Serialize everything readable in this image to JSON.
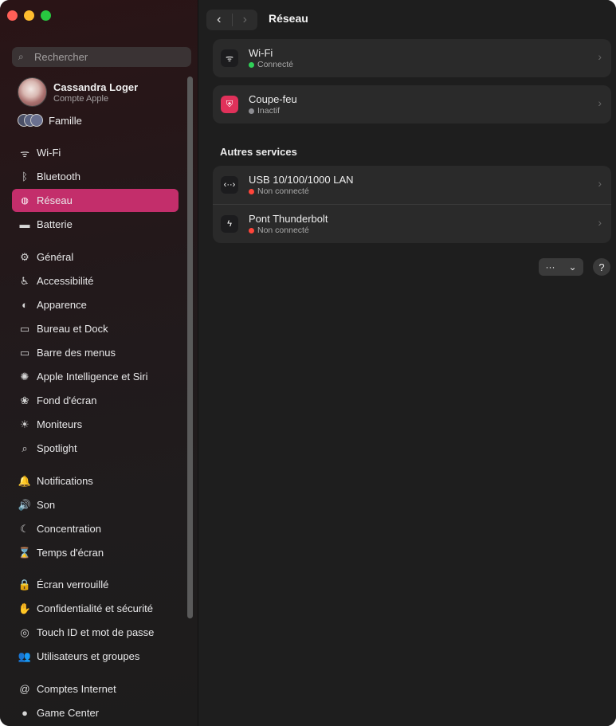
{
  "window": {
    "title": "Réseau"
  },
  "sidebar": {
    "search_placeholder": "Rechercher",
    "account": {
      "name": "Cassandra Loger",
      "subtitle": "Compte Apple"
    },
    "family_label": "Famille",
    "items": [
      {
        "label": "Wi-Fi",
        "icon": "wifi-icon",
        "glyph": "ᯤ",
        "color": "#3a3a3a"
      },
      {
        "label": "Bluetooth",
        "icon": "bluetooth-icon",
        "glyph": "ᛒ",
        "color": "#3a3a3a"
      },
      {
        "label": "Réseau",
        "icon": "globe-icon",
        "glyph": "◍",
        "color": "#c32e6b"
      },
      {
        "label": "Batterie",
        "icon": "battery-icon",
        "glyph": "▬",
        "color": "#3a3a3a"
      },
      {
        "label": "Général",
        "icon": "gear-icon",
        "glyph": "⚙",
        "color": "#3a3a3a"
      },
      {
        "label": "Accessibilité",
        "icon": "accessibility-icon",
        "glyph": "♿",
        "color": "#3a3a3a"
      },
      {
        "label": "Apparence",
        "icon": "appearance-icon",
        "glyph": "◐",
        "color": "#3a3a3a"
      },
      {
        "label": "Bureau et Dock",
        "icon": "dock-icon",
        "glyph": "▭",
        "color": "#3a3a3a"
      },
      {
        "label": "Barre des menus",
        "icon": "menubar-icon",
        "glyph": "▭",
        "color": "#3a3a3a"
      },
      {
        "label": "Apple Intelligence et Siri",
        "icon": "siri-icon",
        "glyph": "✺",
        "color": "#3a3a3a"
      },
      {
        "label": "Fond d'écran",
        "icon": "wallpaper-icon",
        "glyph": "❀",
        "color": "#3a3a3a"
      },
      {
        "label": "Moniteurs",
        "icon": "displays-icon",
        "glyph": "☀",
        "color": "#3a3a3a"
      },
      {
        "label": "Spotlight",
        "icon": "spotlight-icon",
        "glyph": "⌕",
        "color": "#3a3a3a"
      },
      {
        "label": "Notifications",
        "icon": "notifications-icon",
        "glyph": "🔔",
        "color": "#3a3a3a"
      },
      {
        "label": "Son",
        "icon": "sound-icon",
        "glyph": "🔊",
        "color": "#3a3a3a"
      },
      {
        "label": "Concentration",
        "icon": "focus-icon",
        "glyph": "☾",
        "color": "#3a3a3a"
      },
      {
        "label": "Temps d'écran",
        "icon": "screen-time-icon",
        "glyph": "⌛",
        "color": "#3a3a3a"
      },
      {
        "label": "Écran verrouillé",
        "icon": "lock-screen-icon",
        "glyph": "🔒",
        "color": "#3a3a3a"
      },
      {
        "label": "Confidentialité et sécurité",
        "icon": "privacy-hand-icon",
        "glyph": "✋",
        "color": "#3a3a3a"
      },
      {
        "label": "Touch ID et mot de passe",
        "icon": "fingerprint-icon",
        "glyph": "◎",
        "color": "#3a3a3a"
      },
      {
        "label": "Utilisateurs et groupes",
        "icon": "users-icon",
        "glyph": "👥",
        "color": "#3a3a3a"
      },
      {
        "label": "Comptes Internet",
        "icon": "at-icon",
        "glyph": "@",
        "color": "#3a3a3a"
      },
      {
        "label": "Game Center",
        "icon": "game-center-icon",
        "glyph": "●",
        "color": "#3a3a3a"
      }
    ]
  },
  "main": {
    "services": [
      {
        "name": "Wi-Fi",
        "status": "Connecté",
        "status_color": "#30d158",
        "icon": "wifi-icon",
        "glyph": "ᯤ"
      },
      {
        "name": "Coupe-feu",
        "status": "Inactif",
        "status_color": "#8e8e93",
        "icon": "firewall-icon",
        "glyph": "⛨"
      }
    ],
    "other_title": "Autres services",
    "other_services": [
      {
        "name": "USB 10/100/1000 LAN",
        "status": "Non connecté",
        "status_color": "#ff453a",
        "icon": "ethernet-icon",
        "glyph": "‹··›"
      },
      {
        "name": "Pont Thunderbolt",
        "status": "Non connecté",
        "status_color": "#ff453a",
        "icon": "thunderbolt-icon",
        "glyph": "ϟ"
      }
    ],
    "more_button": {
      "ellipsis": "···",
      "chevron": "⌄"
    },
    "help": "?"
  },
  "colors": {
    "accent": "#c32e6b",
    "icon_red": "#e0315a"
  }
}
